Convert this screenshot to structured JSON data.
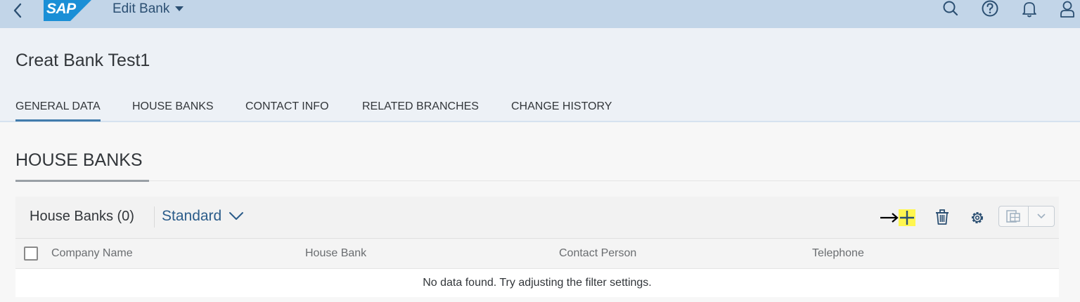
{
  "shell": {
    "logo_text": "SAP",
    "app_title": "Edit Bank",
    "icons": [
      "back-icon",
      "search-icon",
      "help-icon",
      "notifications-icon",
      "user-icon"
    ]
  },
  "header": {
    "title": "Creat Bank Test1",
    "tabs": [
      {
        "label": "GENERAL DATA",
        "active": true
      },
      {
        "label": "HOUSE BANKS",
        "active": false
      },
      {
        "label": "CONTACT INFO",
        "active": false
      },
      {
        "label": "RELATED BRANCHES",
        "active": false
      },
      {
        "label": "CHANGE HISTORY",
        "active": false
      }
    ]
  },
  "section": {
    "title": "HOUSE BANKS"
  },
  "table": {
    "title": "House Banks (0)",
    "variant": "Standard",
    "toolbar_icons": [
      "add-icon",
      "delete-icon",
      "settings-icon",
      "export-icon"
    ],
    "columns": [
      "Company Name",
      "House Bank",
      "Contact Person",
      "Telephone"
    ],
    "empty_text": "No data found. Try adjusting the filter settings."
  },
  "colors": {
    "shell_bg": "#c2d5e8",
    "header_bg": "#edf1f6",
    "accent": "#427cac",
    "highlight": "#fff64f"
  }
}
